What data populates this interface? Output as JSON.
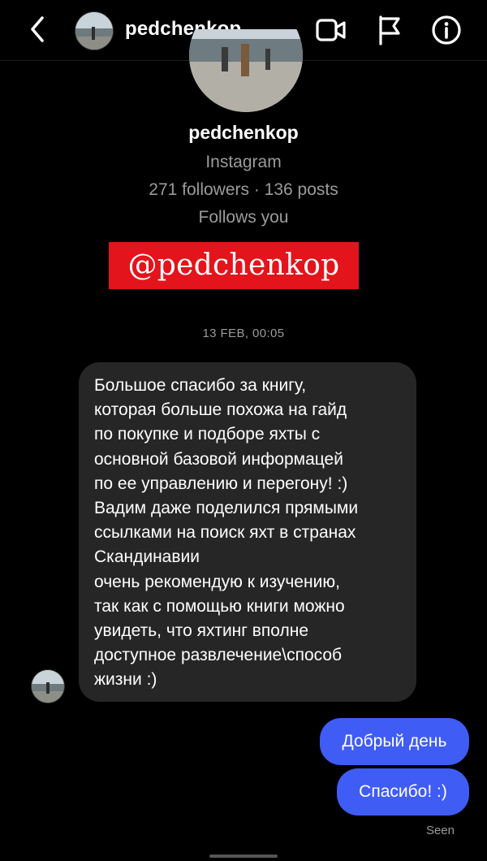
{
  "header": {
    "username": "pedchenkop",
    "icons": [
      "chevron-left-icon",
      "video-call-icon",
      "flag-icon",
      "info-icon"
    ]
  },
  "profile": {
    "name": "pedchenkop",
    "platform": "Instagram",
    "stats": "271 followers · 136 posts",
    "follows": "Follows you"
  },
  "banner": {
    "text": "@pedchenkop",
    "color": "#e3141b"
  },
  "conversation": {
    "timestamp": "13 FEB, 00:05",
    "incoming": {
      "text": "Большое спасибо за книгу,\nкоторая больше похожа на гайд\nпо покупке и подборе яхты с\nосновной базовой информацей\nпо ее управлению и перегону! :)\nВадим даже поделился прямыми\nссылками на поиск яхт в странах\nСкандинавии\nочень рекомендую к изучению,\nтак как с помощью книги можно\nувидеть, что яхтинг вполне\nдоступное развлечение\\способ\nжизни :)"
    },
    "outgoing": [
      {
        "text": "Добрый день"
      },
      {
        "text": "Спасибо! :)"
      }
    ],
    "status": "Seen"
  },
  "colors": {
    "background": "#000000",
    "incoming_bubble": "#262626",
    "outgoing_bubble": "#3f5cf5",
    "muted_text": "#9b9b9b"
  }
}
